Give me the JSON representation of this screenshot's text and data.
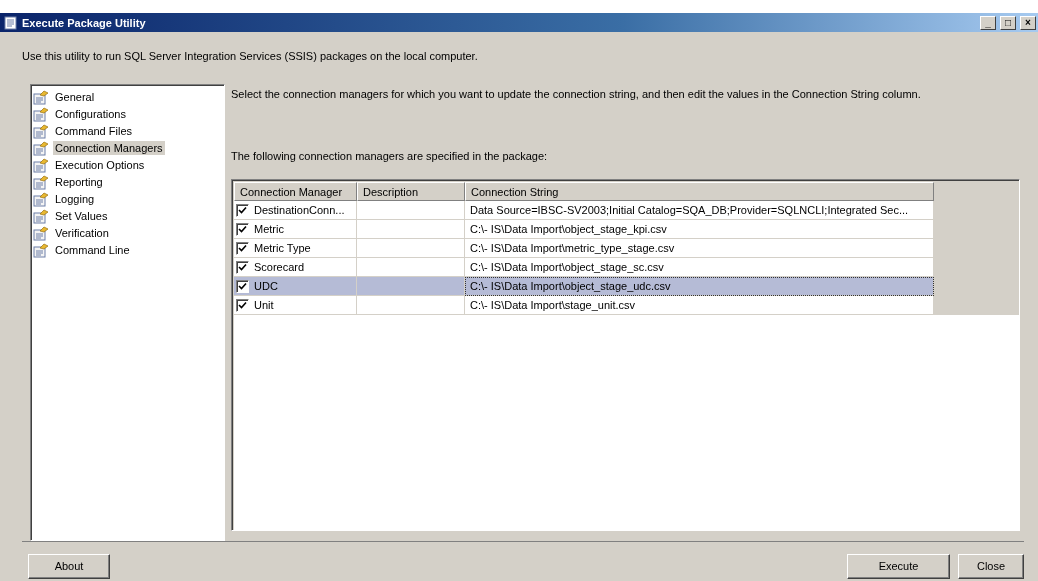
{
  "window": {
    "title": "Execute Package Utility",
    "controls": [
      "_",
      "□",
      "×"
    ]
  },
  "intro": "Use this utility to run SQL Server Integration Services (SSIS) packages on the local computer.",
  "sidebar": {
    "items": [
      {
        "label": "General",
        "selected": false
      },
      {
        "label": "Configurations",
        "selected": false
      },
      {
        "label": "Command Files",
        "selected": false
      },
      {
        "label": "Connection Managers",
        "selected": true
      },
      {
        "label": "Execution Options",
        "selected": false
      },
      {
        "label": "Reporting",
        "selected": false
      },
      {
        "label": "Logging",
        "selected": false
      },
      {
        "label": "Set Values",
        "selected": false
      },
      {
        "label": "Verification",
        "selected": false
      },
      {
        "label": "Command Line",
        "selected": false
      }
    ]
  },
  "instructions": "Select the connection managers for which you want to update the connection string, and then edit the values in the Connection String column.",
  "list_caption": "The following connection managers are specified in the package:",
  "table": {
    "columns": [
      "Connection Manager",
      "Description",
      "Connection String"
    ],
    "rows": [
      {
        "name": "DestinationConn...",
        "checked": true,
        "selected": false,
        "connection_string": "Data Source=IBSC-SV2003;Initial Catalog=SQA_DB;Provider=SQLNCLI;Integrated Sec..."
      },
      {
        "name": "Metric",
        "checked": true,
        "selected": false,
        "connection_string": "C:\\- IS\\Data Import\\object_stage_kpi.csv"
      },
      {
        "name": "Metric Type",
        "checked": true,
        "selected": false,
        "connection_string": "C:\\- IS\\Data Import\\metric_type_stage.csv"
      },
      {
        "name": "Scorecard",
        "checked": true,
        "selected": false,
        "connection_string": "C:\\- IS\\Data Import\\object_stage_sc.csv"
      },
      {
        "name": "UDC",
        "checked": true,
        "selected": true,
        "connection_string": "C:\\- IS\\Data Import\\object_stage_udc.csv"
      },
      {
        "name": "Unit",
        "checked": true,
        "selected": false,
        "connection_string": "C:\\- IS\\Data Import\\stage_unit.csv"
      }
    ]
  },
  "buttons": {
    "left": [
      "About"
    ],
    "right": [
      "Execute",
      "Close"
    ]
  }
}
